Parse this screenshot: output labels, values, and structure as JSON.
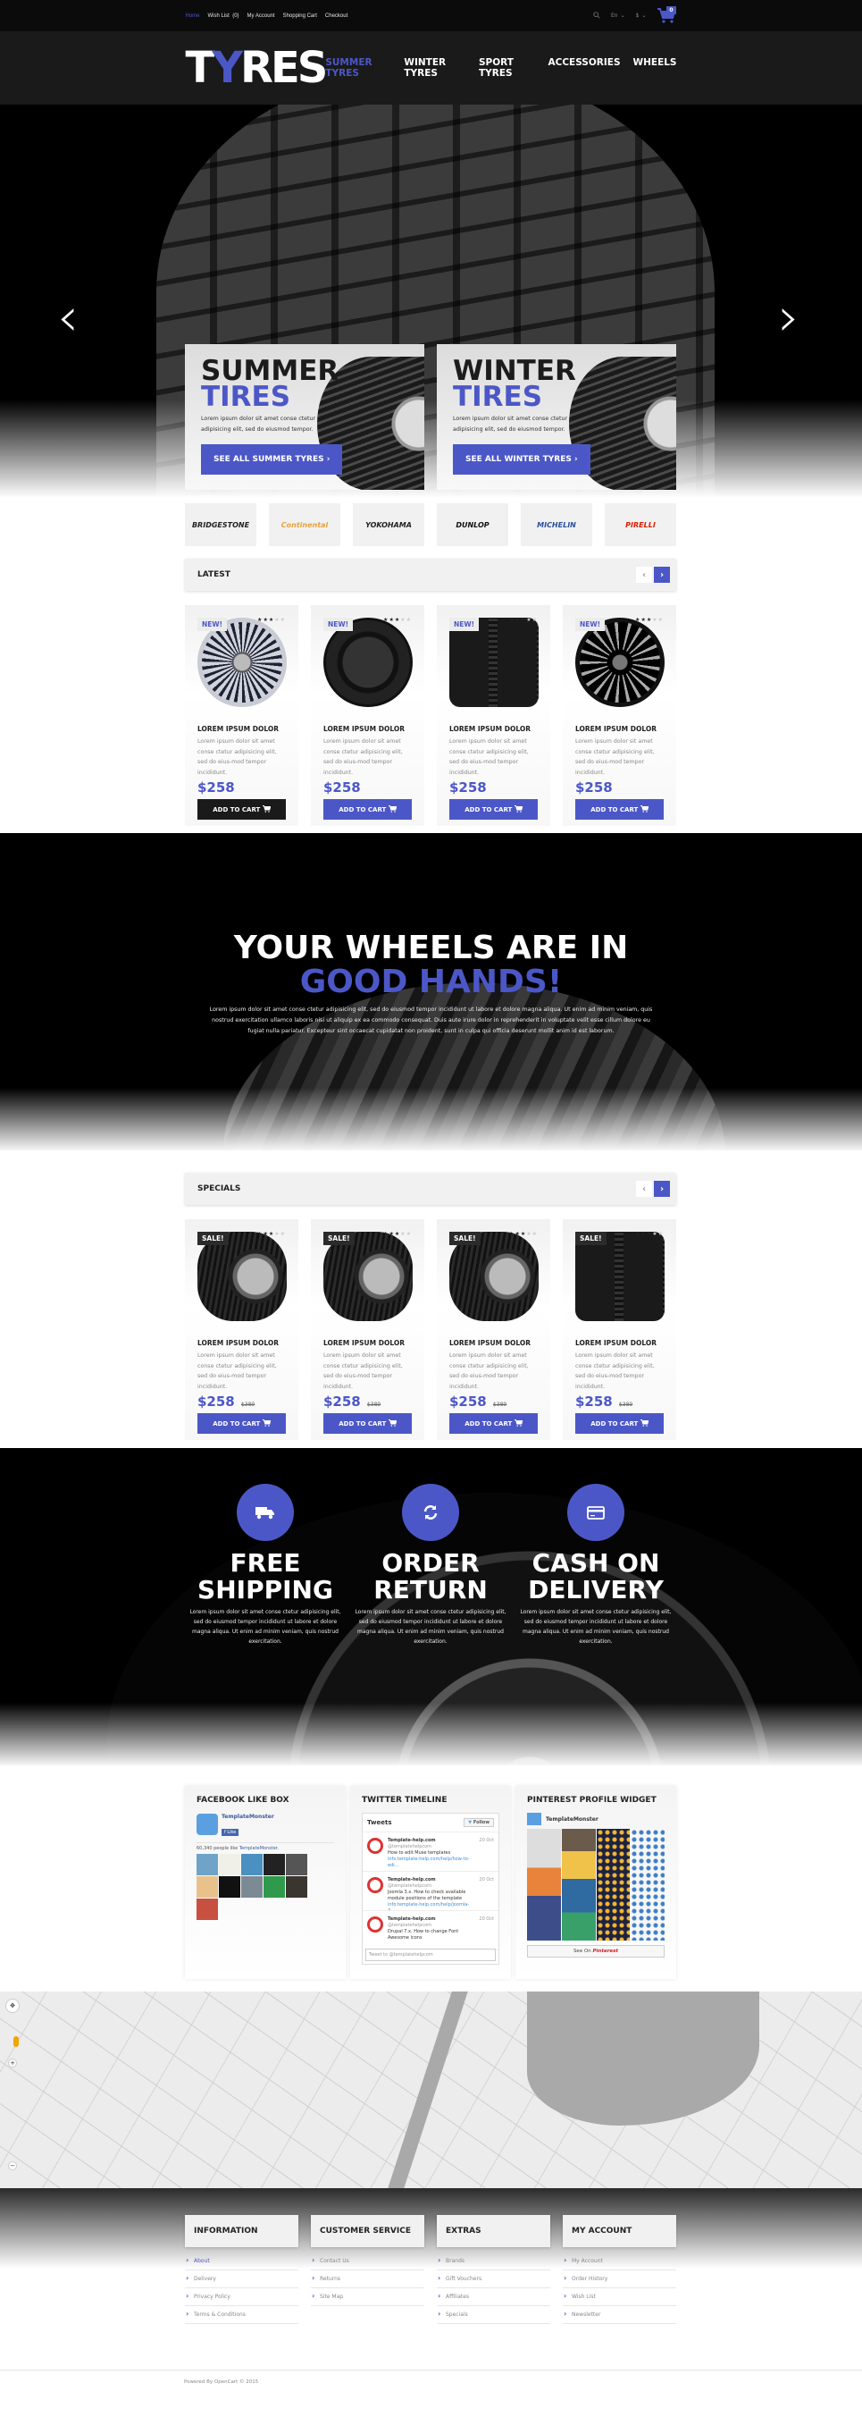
{
  "topbar": {
    "links": [
      "Home",
      "Wish List",
      "(0)",
      "My Account",
      "Shopping Cart",
      "Checkout"
    ],
    "active_link": "Home",
    "language": "En",
    "currency": "$",
    "cart_count": "0",
    "icons": {
      "search": "search-icon",
      "cart": "cart-icon",
      "chevron": "chevron-down-icon"
    }
  },
  "header": {
    "logo_t": "T",
    "logo_y": "Y",
    "logo_rest": "RES",
    "nav": [
      "SUMMER TYRES",
      "WINTER TYRES",
      "SPORT TYRES",
      "ACCESSORIES",
      "WHEELS"
    ],
    "active_nav": "SUMMER TYRES"
  },
  "hero": {
    "prev_arrow": "‹",
    "next_arrow": "›",
    "banners": [
      {
        "line1": "SUMMER",
        "line2": "TIRES",
        "text": "Lorem ipsum dolor sit amet conse ctetur adipisicing elit, sed do eiusmod tempor.",
        "button": "SEE ALL SUMMER TYRES ›"
      },
      {
        "line1": "WINTER",
        "line2": "TIRES",
        "text": "Lorem ipsum dolor sit amet conse ctetur adipisicing elit, sed do eiusmod tempor.",
        "button": "SEE ALL WINTER TYRES ›"
      }
    ]
  },
  "brands": [
    {
      "name": "BRIDGESTONE",
      "color": "#222222"
    },
    {
      "name": "Continental",
      "color": "#e8a33a"
    },
    {
      "name": "YOKOHAMA",
      "color": "#222222"
    },
    {
      "name": "DUNLOP",
      "color": "#111111"
    },
    {
      "name": "MICHELIN",
      "color": "#27509b"
    },
    {
      "name": "PIRELLI",
      "color": "#d81e05"
    }
  ],
  "latest": {
    "title": "LATEST",
    "prev": "‹",
    "next": "›",
    "products": [
      {
        "badge": "NEW!",
        "rating": 3,
        "name": "LOREM IPSUM DOLOR",
        "desc": "Lorem ipsum dolor sit amet conse ctetur adipisicing elit, sed do eius-mod tempor incididunt.",
        "price": "$258",
        "button": "ADD TO CART",
        "image": "silver-rim"
      },
      {
        "badge": "NEW!",
        "rating": 3,
        "name": "LOREM IPSUM DOLOR",
        "desc": "Lorem ipsum dolor sit amet conse ctetur adipisicing elit, sed do eius-mod tempor incididunt.",
        "price": "$258",
        "button": "ADD TO CART",
        "image": "black-tire-wheel"
      },
      {
        "badge": "NEW!",
        "rating": 3,
        "name": "LOREM IPSUM DOLOR",
        "desc": "Lorem ipsum dolor sit amet conse ctetur adipisicing elit, sed do eius-mod tempor incididunt.",
        "price": "$258",
        "button": "ADD TO CART",
        "image": "two-winter-tires"
      },
      {
        "badge": "NEW!",
        "rating": 3,
        "name": "LOREM IPSUM DOLOR",
        "desc": "Lorem ipsum dolor sit amet conse ctetur adipisicing elit, sed do eius-mod tempor incididunt.",
        "price": "$258",
        "button": "ADD TO CART",
        "image": "black-rim"
      }
    ]
  },
  "promo": {
    "line1": "YOUR WHEELS ARE IN",
    "line2": "GOOD HANDS!",
    "text": "Lorem ipsum dolor sit amet conse ctetur adipisicing elit, sed do eiusmod tempor incididunt ut labore et dolore magna aliqua. Ut enim ad minim veniam, quis nostrud exercitation ullamco laboris nisi ut aliquip ex ea commodo consequat. Duis aute irure dolor in reprehenderit in voluptate velit esse cillum dolore eu fugiat nulla pariatur. Excepteur sint occaecat cupidatat non proident, sunt in culpa qui officia deserunt mollit anim id est laborum."
  },
  "specials": {
    "title": "SPECIALS",
    "prev": "‹",
    "next": "›",
    "products": [
      {
        "badge": "SALE!",
        "rating": 3,
        "name": "LOREM IPSUM DOLOR",
        "desc": "Lorem ipsum dolor sit amet conse ctetur adipisicing elit, sed do eius-mod tempor incididunt.",
        "price": "$258",
        "old_price": "$389",
        "button": "ADD TO CART"
      },
      {
        "badge": "SALE!",
        "rating": 3,
        "name": "LOREM IPSUM DOLOR",
        "desc": "Lorem ipsum dolor sit amet conse ctetur adipisicing elit, sed do eius-mod tempor incididunt.",
        "price": "$258",
        "old_price": "$389",
        "button": "ADD TO CART"
      },
      {
        "badge": "SALE!",
        "rating": 3,
        "name": "LOREM IPSUM DOLOR",
        "desc": "Lorem ipsum dolor sit amet conse ctetur adipisicing elit, sed do eius-mod tempor incididunt.",
        "price": "$258",
        "old_price": "$389",
        "button": "ADD TO CART"
      },
      {
        "badge": "SALE!",
        "rating": 3,
        "name": "LOREM IPSUM DOLOR",
        "desc": "Lorem ipsum dolor sit amet conse ctetur adipisicing elit, sed do eius-mod tempor incididunt.",
        "price": "$258",
        "old_price": "$389",
        "button": "ADD TO CART"
      }
    ]
  },
  "features": [
    {
      "icon": "truck-icon",
      "glyph": "🚚",
      "line1": "FREE",
      "line2": "SHIPPING",
      "text": "Lorem ipsum dolor sit amet conse ctetur adipisicing elit, sed do eiusmod tempor incididunt ut labore et dolore magna aliqua. Ut enim ad minim veniam, quis nostrud exercitation."
    },
    {
      "icon": "refresh-icon",
      "glyph": "⟳",
      "line1": "ORDER",
      "line2": "RETURN",
      "text": "Lorem ipsum dolor sit amet conse ctetur adipisicing elit, sed do eiusmod tempor incididunt ut labore et dolore magna aliqua. Ut enim ad minim veniam, quis nostrud exercitation."
    },
    {
      "icon": "credit-card-icon",
      "glyph": "▭",
      "line1": "CASH ON",
      "line2": "DELIVERY",
      "text": "Lorem ipsum dolor sit amet conse ctetur adipisicing elit, sed do eiusmod tempor incididunt ut labore et dolore magna aliqua. Ut enim ad minim veniam, quis nostrud exercitation."
    }
  ],
  "widgets": {
    "facebook": {
      "title": "FACEBOOK LIKE BOX",
      "page": "TemplateMonster",
      "like": "Like",
      "count_text": "60,340 people like",
      "count_link": "TemplateMonster."
    },
    "twitter": {
      "title": "TWITTER TIMELINE",
      "tweets_label": "Tweets",
      "follow": "Follow",
      "tweets": [
        {
          "name": "Template-help.com",
          "handle": "@templatehelpcom",
          "date": "20 Oct",
          "text": "How to edit Muse templates",
          "link": "info.template-help.com/help/how-to-edi..."
        },
        {
          "name": "Template-help.com",
          "handle": "@templatehelpcom",
          "date": "20 Oct",
          "text": "Joomla 3.x. How to check available module positions of the template",
          "link": "info.template-help.com/help/joomla-3-..."
        },
        {
          "name": "Template-help.com",
          "handle": "@templatehelpcom",
          "date": "20 Oct",
          "text": "Drupal 7.x. How to change Font Awesome icons",
          "link": ""
        }
      ],
      "input_placeholder": "Tweet to @templatehelpcom"
    },
    "pinterest": {
      "title": "PINTEREST PROFILE WIDGET",
      "profile": "TemplateMonster",
      "see_on": "See On",
      "brand": "Pinterest"
    }
  },
  "footer": {
    "columns": [
      {
        "title": "INFORMATION",
        "links": [
          "About",
          "Delivery",
          "Privacy Policy",
          "Terms & Conditions"
        ]
      },
      {
        "title": "CUSTOMER SERVICE",
        "links": [
          "Contact Us",
          "Returns",
          "Site Map"
        ]
      },
      {
        "title": "EXTRAS",
        "links": [
          "Brands",
          "Gift Vouchers",
          "Affiliates",
          "Specials"
        ]
      },
      {
        "title": "MY ACCOUNT",
        "links": [
          "My Account",
          "Order History",
          "Wish List",
          "Newsletter"
        ]
      }
    ],
    "active_link": "About",
    "copyright": "Powered By OpenCart © 2015"
  },
  "colors": {
    "accent": "#4c57c7",
    "dark": "#1a1a1a",
    "panel": "#f1f1f1"
  }
}
